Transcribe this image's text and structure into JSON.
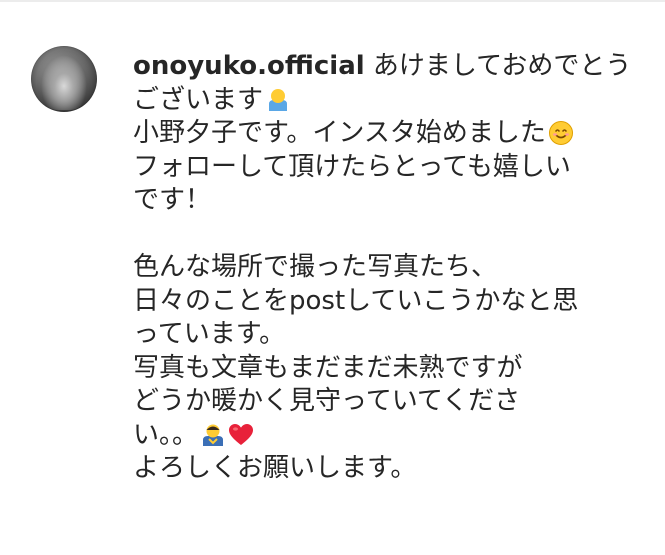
{
  "comment": {
    "username": "onoyuko.official",
    "lines": [
      {
        "text": " あけましておめでとう"
      },
      {
        "text": "ございます",
        "emoji": "person-bowing-emoji"
      },
      {
        "text": "小野夕子です。インスタ始めました",
        "emoji": "smiling-face-emoji"
      },
      {
        "text": "フォローして頂けたらとっても嬉しい"
      },
      {
        "text": "です！"
      },
      {
        "text": ""
      },
      {
        "text": "色んな場所で撮った写真たち、"
      },
      {
        "text": "日々のことをpostしていこうかなと思"
      },
      {
        "text": "っています。"
      },
      {
        "text": "写真も文章もまだまだ未熟ですが"
      },
      {
        "text": "どうか暖かく見守っていてくださ"
      },
      {
        "text": "い。。",
        "emoji": "person-bowing-emoji",
        "emoji2": "red-heart-emoji"
      },
      {
        "text": "よろしくお願いします。"
      }
    ]
  },
  "colors": {
    "text": "#262626",
    "divider": "#ececec",
    "heart": "#e8213a",
    "emoji_yellow": "#ffcc33"
  }
}
